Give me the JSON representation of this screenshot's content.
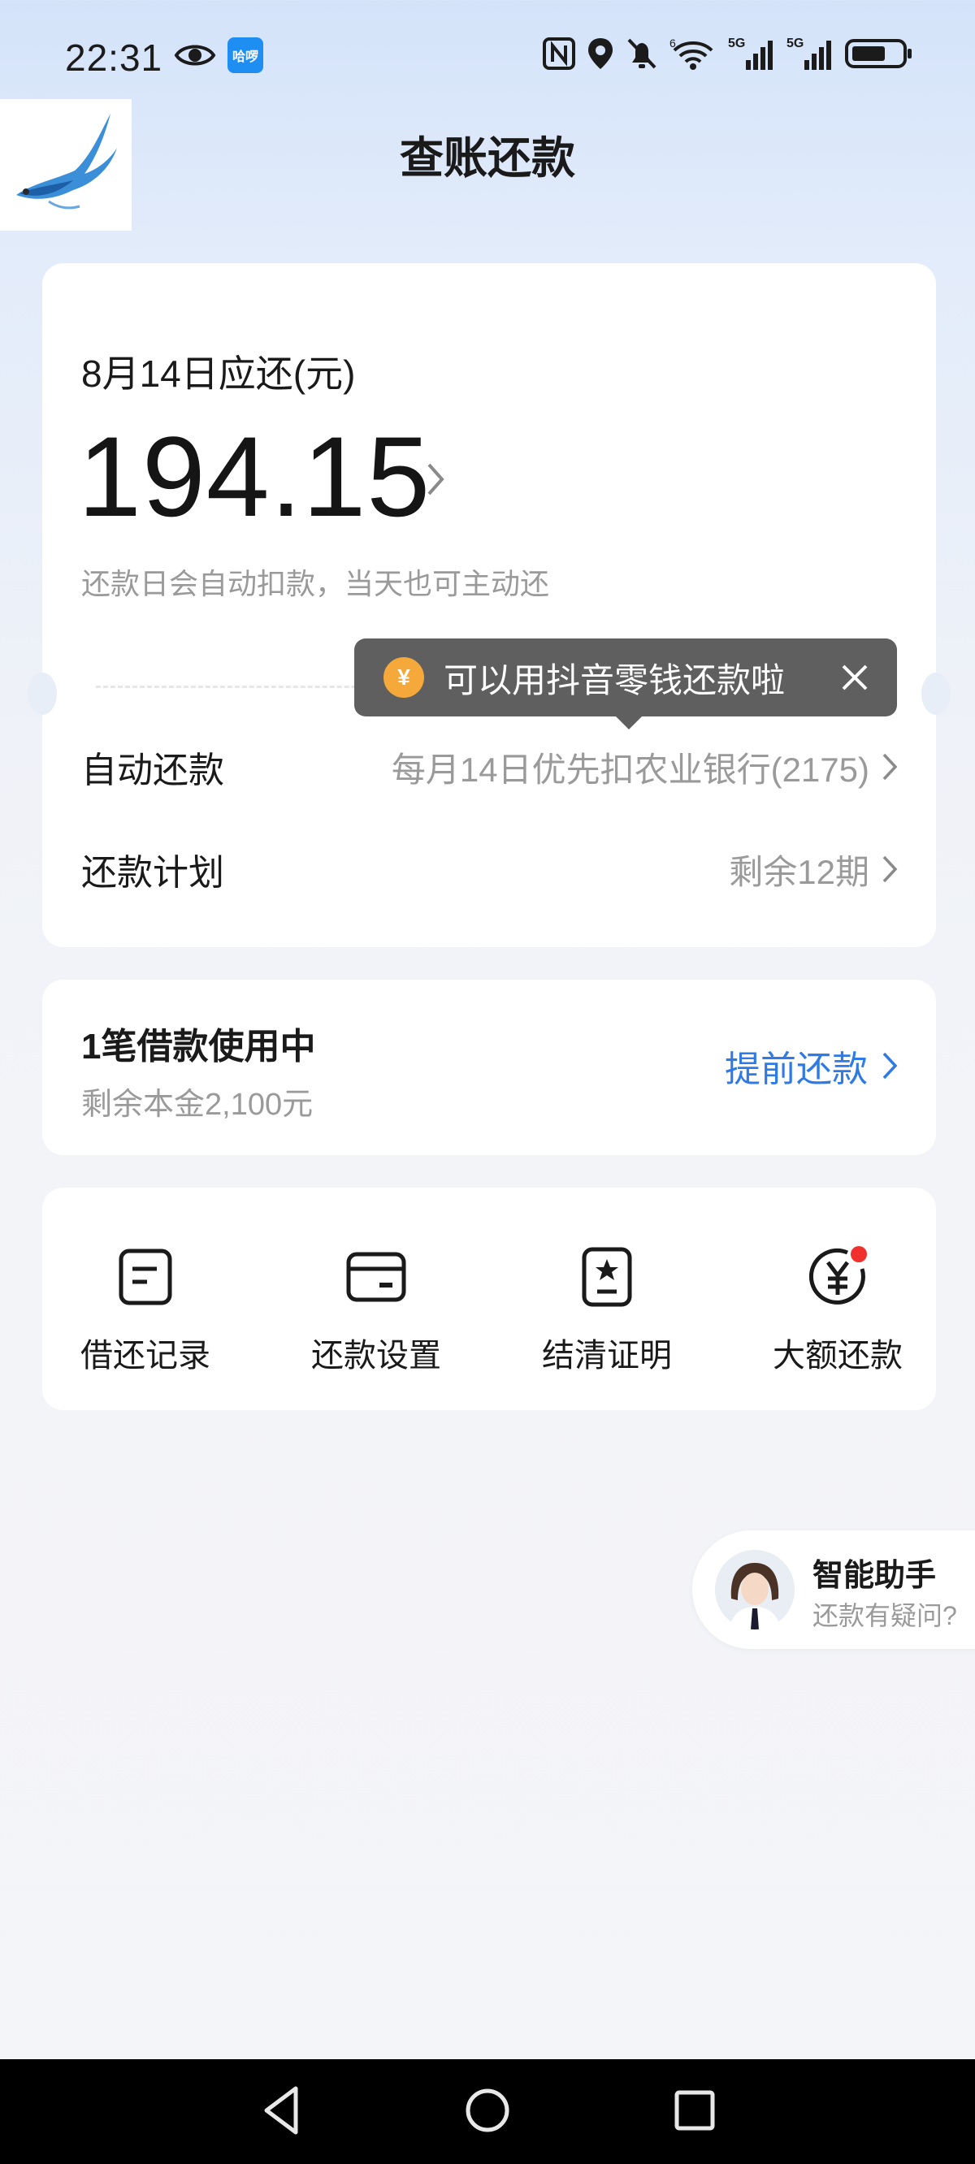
{
  "status_bar": {
    "time": "22:31",
    "left_icons": [
      "eye-icon",
      "haluo-app-icon"
    ],
    "app_badge_text": "哈啰",
    "right_icons": [
      "nfc-icon",
      "location-icon",
      "mute-bell-icon",
      "wifi-icon",
      "signal-5g-icon",
      "signal-5g-icon",
      "battery-icon"
    ],
    "wifi_tag": "6",
    "signal_tag": "5G"
  },
  "header": {
    "title": "查账还款",
    "logo_icon": "swallow-bird-logo"
  },
  "bill": {
    "due_label": "8月14日应还(元)",
    "amount": "194.15",
    "note": "还款日会自动扣款，当天也可主动还",
    "tooltip_text": "可以用抖音零钱还款啦",
    "tooltip_coin": "¥",
    "auto_label": "自动还款",
    "auto_value": "每月14日优先扣农业银行(2175)",
    "plan_label": "还款计划",
    "plan_value": "剩余12期"
  },
  "loan": {
    "title": "1笔借款使用中",
    "remaining": "剩余本金2,100元",
    "prepay_label": "提前还款"
  },
  "tools": [
    {
      "label": "借还记录",
      "icon": "record-document-icon"
    },
    {
      "label": "还款设置",
      "icon": "wallet-icon"
    },
    {
      "label": "结清证明",
      "icon": "certificate-star-icon"
    },
    {
      "label": "大额还款",
      "icon": "yuan-circle-icon",
      "badge": "red-dot"
    }
  ],
  "assistant": {
    "title": "智能助手",
    "subtitle": "还款有疑问?"
  },
  "colors": {
    "accent": "#2f7ae5",
    "tooltip_bg": "#5f5f5f",
    "coin": "#f4a93a",
    "badge": "#f0302c"
  }
}
